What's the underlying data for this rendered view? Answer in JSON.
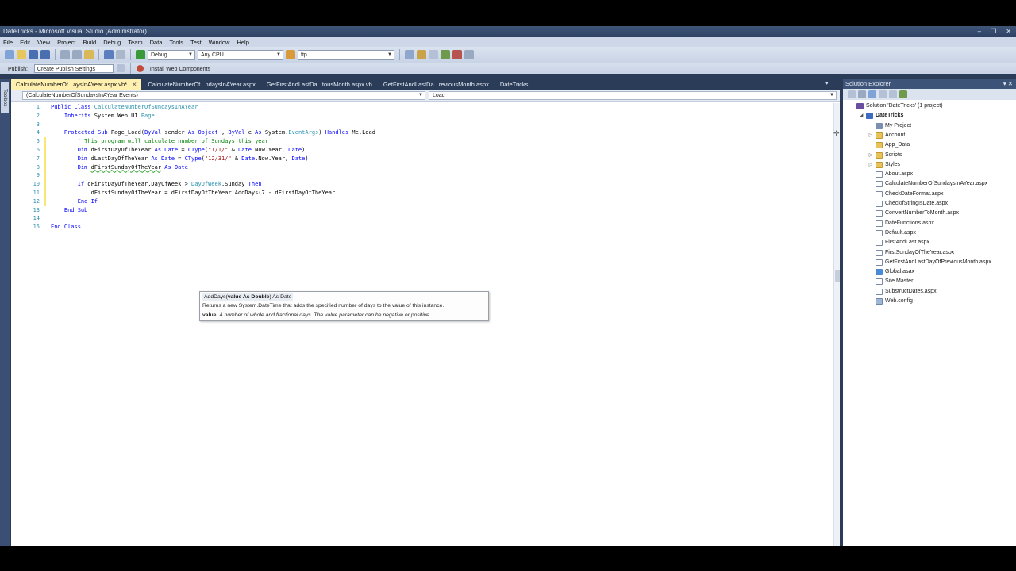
{
  "window": {
    "title": "DateTricks - Microsoft Visual Studio (Administrator)",
    "controls": [
      "–",
      "❐",
      "✕"
    ]
  },
  "menu": [
    "File",
    "Edit",
    "View",
    "Project",
    "Build",
    "Debug",
    "Team",
    "Data",
    "Tools",
    "Test",
    "Window",
    "Help"
  ],
  "toolbar": {
    "config": "Debug",
    "platform": "Any CPU",
    "find": "ftp"
  },
  "toolbar2": {
    "publish": "Publish:",
    "publish_profile": "Create Publish Settings",
    "install": "Install Web Components"
  },
  "toolbox_label": "Toolbox",
  "tabs": [
    {
      "label": "CalculateNumberOf...aysInAYear.aspx.vb*",
      "active": true
    },
    {
      "label": "CalculateNumberOf...ndaysInAYear.aspx",
      "active": false
    },
    {
      "label": "GetFirstAndLastDa...tousMonth.aspx.vb",
      "active": false
    },
    {
      "label": "GetFirstAndLastDa...reviousMonth.aspx",
      "active": false
    },
    {
      "label": "DateTricks",
      "active": false
    }
  ],
  "tab_close": "✕",
  "nav": {
    "left": "(CalculateNumberOfSundaysInAYear Events)",
    "right": "Load"
  },
  "code_lines": [
    {
      "n": "1",
      "mod": false,
      "segs": [
        [
          "kw",
          "Public Class "
        ],
        [
          "ty",
          "CalculateNumberOfSundaysInAYear"
        ]
      ]
    },
    {
      "n": "2",
      "mod": false,
      "segs": [
        [
          "kw",
          "    Inherits "
        ],
        [
          "",
          "System.Web.UI."
        ],
        [
          "ty",
          "Page"
        ]
      ]
    },
    {
      "n": "3",
      "mod": false,
      "segs": [
        [
          "",
          ""
        ]
      ]
    },
    {
      "n": "4",
      "mod": false,
      "segs": [
        [
          "kw",
          "    Protected Sub "
        ],
        [
          "",
          "Page_Load("
        ],
        [
          "kw",
          "ByVal "
        ],
        [
          "",
          "sender "
        ],
        [
          "kw",
          "As Object"
        ],
        [
          "",
          " , "
        ],
        [
          "kw",
          "ByVal "
        ],
        [
          "",
          "e "
        ],
        [
          "kw",
          "As "
        ],
        [
          "",
          "System."
        ],
        [
          "ty",
          "EventArgs"
        ],
        [
          "",
          ") "
        ],
        [
          "kw",
          "Handles "
        ],
        [
          "",
          "Me.Load"
        ]
      ]
    },
    {
      "n": "5",
      "mod": true,
      "segs": [
        [
          "cm",
          "        ' This program will calculate number of Sundays this year"
        ]
      ]
    },
    {
      "n": "6",
      "mod": true,
      "segs": [
        [
          "kw",
          "        Dim "
        ],
        [
          "",
          "dFirstDayOfTheYear "
        ],
        [
          "kw",
          "As Date "
        ],
        [
          "",
          "= "
        ],
        [
          "kw",
          "CType"
        ],
        [
          "",
          "("
        ],
        [
          "st",
          "\"1/1/\""
        ],
        [
          "",
          " & "
        ],
        [
          "kw",
          "Date"
        ],
        [
          "",
          ".Now.Year, "
        ],
        [
          "kw",
          "Date"
        ],
        [
          "",
          ")"
        ]
      ]
    },
    {
      "n": "7",
      "mod": true,
      "segs": [
        [
          "kw",
          "        Dim "
        ],
        [
          "",
          "dLastDayOfTheYear "
        ],
        [
          "kw",
          "As Date "
        ],
        [
          "",
          "= "
        ],
        [
          "kw",
          "CType"
        ],
        [
          "",
          "("
        ],
        [
          "st",
          "\"12/31/\""
        ],
        [
          "",
          " & "
        ],
        [
          "kw",
          "Date"
        ],
        [
          "",
          ".Now.Year, "
        ],
        [
          "kw",
          "Date"
        ],
        [
          "",
          ")"
        ]
      ]
    },
    {
      "n": "8",
      "mod": true,
      "segs": [
        [
          "kw",
          "        Dim "
        ],
        [
          "sq",
          "dFirstSundayOfTheYear"
        ],
        [
          "kw",
          " As Date"
        ]
      ]
    },
    {
      "n": "9",
      "mod": true,
      "segs": [
        [
          "",
          ""
        ]
      ]
    },
    {
      "n": "10",
      "mod": true,
      "segs": [
        [
          "kw",
          "        If "
        ],
        [
          "",
          "dFirstDayOfTheYear.DayOfWeek > "
        ],
        [
          "ty",
          "DayOfWeek"
        ],
        [
          "",
          ".Sunday "
        ],
        [
          "kw",
          "Then"
        ]
      ]
    },
    {
      "n": "11",
      "mod": true,
      "segs": [
        [
          "",
          "            dFirstSundayOfTheYear = dFirstDayOfTheYear.AddDays(7 - dFirstDayOfTheYear"
        ]
      ]
    },
    {
      "n": "12",
      "mod": true,
      "segs": [
        [
          "kw",
          "        End If"
        ]
      ]
    },
    {
      "n": "13",
      "mod": false,
      "segs": [
        [
          "kw",
          "    End Sub"
        ]
      ]
    },
    {
      "n": "14",
      "mod": false,
      "segs": [
        [
          "",
          ""
        ]
      ]
    },
    {
      "n": "15",
      "mod": false,
      "segs": [
        [
          "kw",
          "End Class"
        ]
      ]
    }
  ],
  "tooltip": {
    "sig_name": "AddDays(",
    "sig_param": "value As Double",
    "sig_rest": ") As Date",
    "description": "Returns a new System.DateTime that adds the specified number of days to the value of this instance.",
    "param_name": "value:",
    "param_desc": " A number of whole and fractional days. The value parameter can be negative or positive."
  },
  "solution_explorer": {
    "title": "Solution Explorer",
    "controls": "▾ ✕",
    "nodes": [
      {
        "label": "Solution 'DateTricks' (1 project)",
        "indent": 0,
        "icon": "sol",
        "exp": ""
      },
      {
        "label": "DateTricks",
        "indent": 1,
        "icon": "proj",
        "exp": "◢",
        "bold": true
      },
      {
        "label": "My Project",
        "indent": 2,
        "icon": "myproj",
        "exp": ""
      },
      {
        "label": "Account",
        "indent": 2,
        "icon": "folder",
        "exp": "▷"
      },
      {
        "label": "App_Data",
        "indent": 2,
        "icon": "folder",
        "exp": ""
      },
      {
        "label": "Scripts",
        "indent": 2,
        "icon": "folder",
        "exp": "▷"
      },
      {
        "label": "Styles",
        "indent": 2,
        "icon": "folder",
        "exp": "▷"
      },
      {
        "label": "About.aspx",
        "indent": 2,
        "icon": "page",
        "exp": ""
      },
      {
        "label": "CalculateNumberOfSundaysInAYear.aspx",
        "indent": 2,
        "icon": "page",
        "exp": ""
      },
      {
        "label": "CheckDateFormat.aspx",
        "indent": 2,
        "icon": "page",
        "exp": ""
      },
      {
        "label": "CheckIfStringIsDate.aspx",
        "indent": 2,
        "icon": "page",
        "exp": ""
      },
      {
        "label": "ConvertNumberToMonth.aspx",
        "indent": 2,
        "icon": "page",
        "exp": ""
      },
      {
        "label": "DateFunctions.aspx",
        "indent": 2,
        "icon": "page",
        "exp": ""
      },
      {
        "label": "Default.aspx",
        "indent": 2,
        "icon": "page",
        "exp": ""
      },
      {
        "label": "FirstAndLast.aspx",
        "indent": 2,
        "icon": "page",
        "exp": ""
      },
      {
        "label": "FirstSundayOfTheYear.aspx",
        "indent": 2,
        "icon": "page",
        "exp": ""
      },
      {
        "label": "GetFirstAndLastDayOfPreviousMonth.aspx",
        "indent": 2,
        "icon": "page",
        "exp": ""
      },
      {
        "label": "Global.asax",
        "indent": 2,
        "icon": "global",
        "exp": ""
      },
      {
        "label": "Site.Master",
        "indent": 2,
        "icon": "page",
        "exp": ""
      },
      {
        "label": "SubstructDates.aspx",
        "indent": 2,
        "icon": "page",
        "exp": ""
      },
      {
        "label": "Web.config",
        "indent": 2,
        "icon": "config",
        "exp": ""
      }
    ]
  },
  "colors": {
    "keyword": "#0000ff",
    "type": "#2b91af",
    "comment": "#008000",
    "string": "#a31515",
    "chrome": "#2b3c59"
  }
}
